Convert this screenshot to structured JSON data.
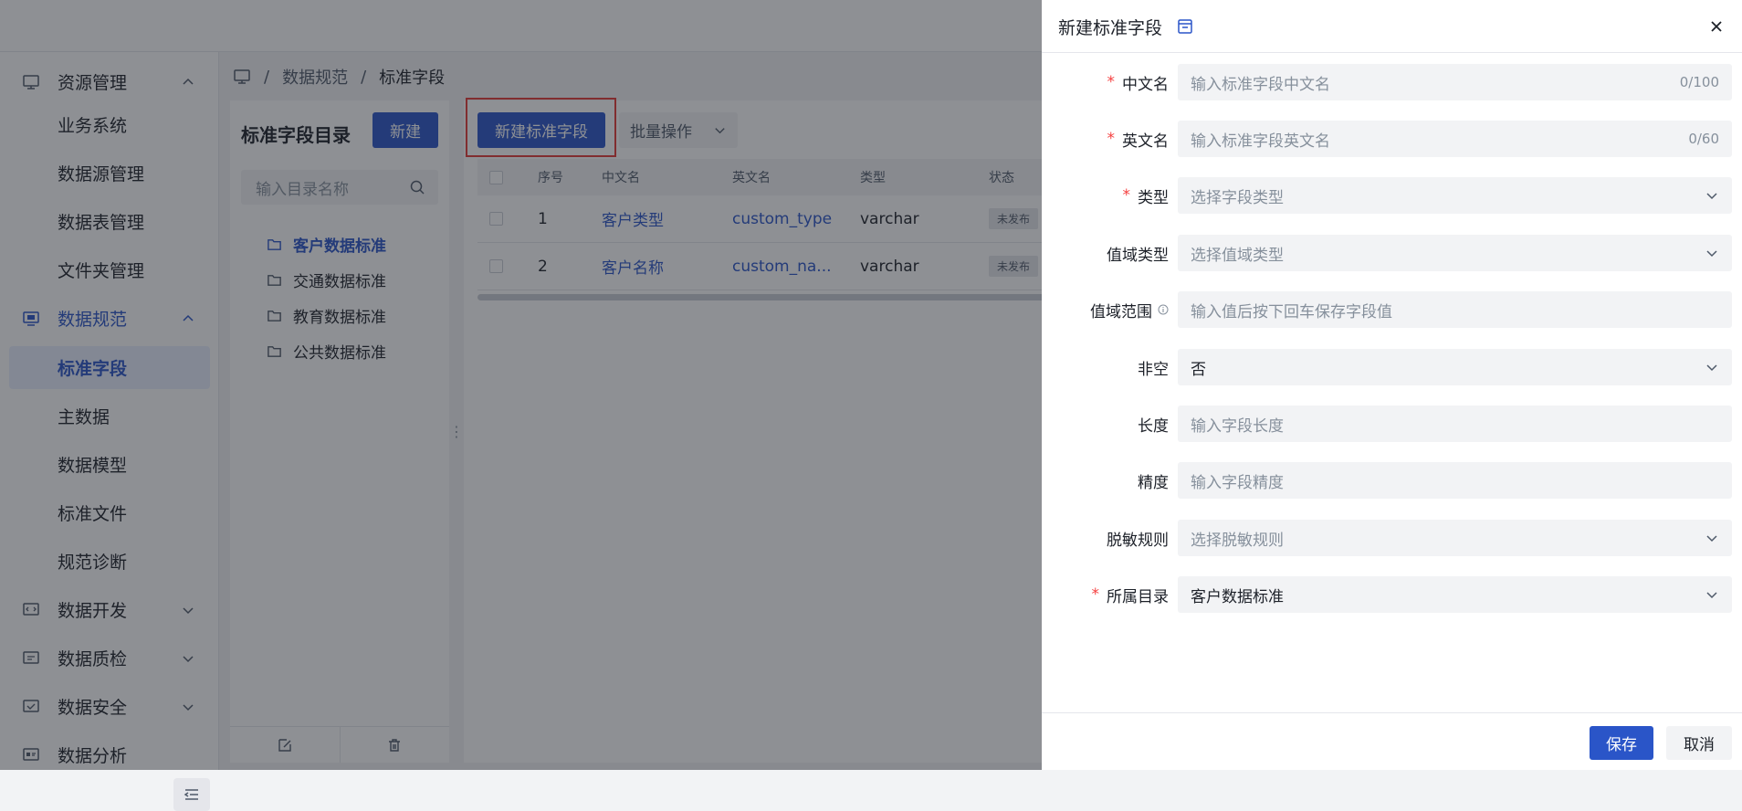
{
  "sidebar": {
    "items": [
      {
        "label": "资源管理",
        "kind": "group",
        "icon": "monitor-icon",
        "expanded": true
      },
      {
        "label": "业务系统",
        "kind": "sub"
      },
      {
        "label": "数据源管理",
        "kind": "sub"
      },
      {
        "label": "数据表管理",
        "kind": "sub"
      },
      {
        "label": "文件夹管理",
        "kind": "sub"
      },
      {
        "label": "数据规范",
        "kind": "group",
        "icon": "spec-icon",
        "expanded": true
      },
      {
        "label": "标准字段",
        "kind": "sub",
        "active": true
      },
      {
        "label": "主数据",
        "kind": "sub"
      },
      {
        "label": "数据模型",
        "kind": "sub"
      },
      {
        "label": "标准文件",
        "kind": "sub"
      },
      {
        "label": "规范诊断",
        "kind": "sub"
      },
      {
        "label": "数据开发",
        "kind": "group",
        "icon": "code-icon",
        "expanded": false
      },
      {
        "label": "数据质检",
        "kind": "group",
        "icon": "quality-icon",
        "expanded": false
      },
      {
        "label": "数据安全",
        "kind": "group",
        "icon": "security-icon",
        "expanded": false
      },
      {
        "label": "数据分析",
        "kind": "group",
        "icon": "analysis-icon",
        "expanded": false
      }
    ]
  },
  "breadcrumb": {
    "root_icon": "monitor-icon",
    "sep": "/",
    "level1": "数据规范",
    "level2": "标准字段"
  },
  "directory": {
    "title": "标准字段目录",
    "new_label": "新建",
    "search_placeholder": "输入目录名称",
    "items": [
      {
        "label": "客户数据标准",
        "selected": true
      },
      {
        "label": "交通数据标准"
      },
      {
        "label": "教育数据标准"
      },
      {
        "label": "公共数据标准"
      }
    ]
  },
  "toolbar": {
    "new_field_label": "新建标准字段",
    "batch_label": "批量操作"
  },
  "table": {
    "columns": [
      "序号",
      "中文名",
      "英文名",
      "类型",
      "状态"
    ],
    "rows": [
      {
        "index": "1",
        "cn": "客户类型",
        "en": "custom_type",
        "type": "varchar",
        "status": "未发布"
      },
      {
        "index": "2",
        "cn": "客户名称",
        "en": "custom_na...",
        "type": "varchar",
        "status": "未发布"
      }
    ]
  },
  "drawer": {
    "title": "新建标准字段",
    "fields": [
      {
        "name": "chinese-name",
        "label": "中文名",
        "required": true,
        "control": "input",
        "placeholder": "输入标准字段中文名",
        "count": "0/100"
      },
      {
        "name": "english-name",
        "label": "英文名",
        "required": true,
        "control": "input",
        "placeholder": "输入标准字段英文名",
        "count": "0/60"
      },
      {
        "name": "type",
        "label": "类型",
        "required": true,
        "control": "select",
        "placeholder": "选择字段类型"
      },
      {
        "name": "value-domain-type",
        "label": "值域类型",
        "required": false,
        "control": "select",
        "placeholder": "选择值域类型"
      },
      {
        "name": "value-domain-range",
        "label": "值域范围",
        "required": false,
        "control": "input",
        "placeholder": "输入值后按下回车保存字段值",
        "info": true
      },
      {
        "name": "not-null",
        "label": "非空",
        "required": false,
        "control": "select",
        "value": "否"
      },
      {
        "name": "length",
        "label": "长度",
        "required": false,
        "control": "input",
        "placeholder": "输入字段长度"
      },
      {
        "name": "precision",
        "label": "精度",
        "required": false,
        "control": "input",
        "placeholder": "输入字段精度"
      },
      {
        "name": "masking-rule",
        "label": "脱敏规则",
        "required": false,
        "control": "select",
        "placeholder": "选择脱敏规则"
      },
      {
        "name": "directory",
        "label": "所属目录",
        "required": true,
        "control": "select",
        "value": "客户数据标准"
      }
    ],
    "save_label": "保存",
    "cancel_label": "取消"
  },
  "colors": {
    "primary": "#2a55c8",
    "required": "#f53f3f",
    "highlight": "#e53935",
    "mask": "rgba(29,33,41,0.5)"
  }
}
